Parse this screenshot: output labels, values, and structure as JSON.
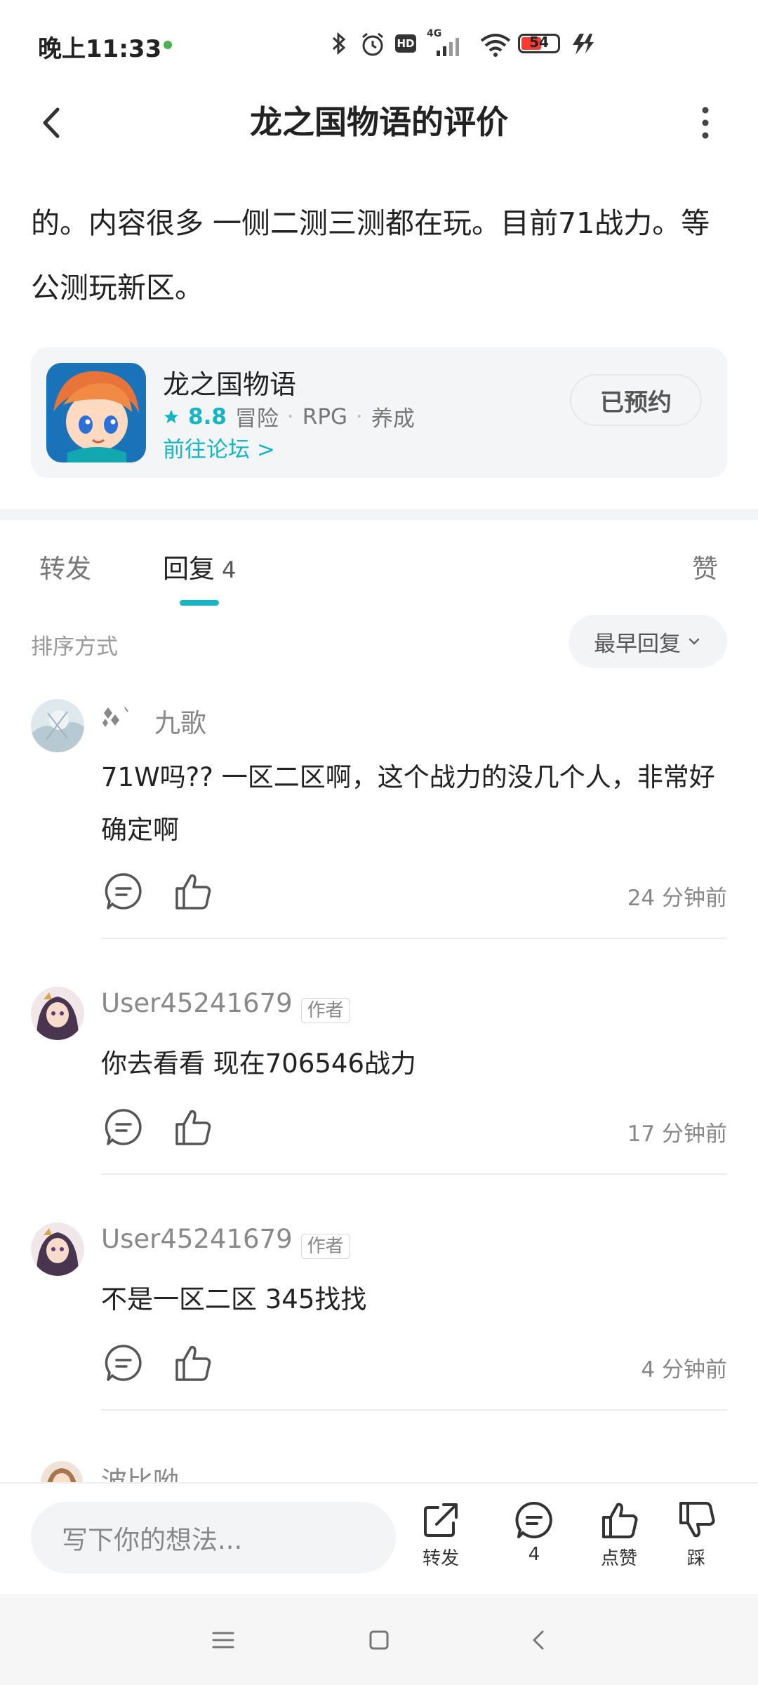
{
  "status_bar": {
    "time": "晚上11:33",
    "battery": "54",
    "network": "4G",
    "hd": "HD"
  },
  "header": {
    "title": "龙之国物语的评价"
  },
  "review": {
    "text": "的。内容很多 一侧二测三测都在玩。目前71战力。等公测玩新区。"
  },
  "game_card": {
    "name": "龙之国物语",
    "rating": "8.8",
    "tags": [
      "冒险",
      "RPG",
      "养成"
    ],
    "forum_link": "前往论坛 >",
    "reserve_button": "已预约"
  },
  "tabs": {
    "forward": "转发",
    "reply": "回复",
    "reply_count": "4",
    "like": "赞"
  },
  "sort": {
    "label": "排序方式",
    "button": "最早回复"
  },
  "comments": [
    {
      "username": "九歌",
      "text": "71W吗?? 一区二区啊，这个战力的没几个人，非常好确定啊",
      "time": "24 分钟前"
    },
    {
      "username": "User45241679",
      "tag": "作者",
      "text": "你去看看 现在706546战力",
      "time": "17 分钟前"
    },
    {
      "username": "User45241679",
      "tag": "作者",
      "text": "不是一区二区 345找找",
      "time": "4 分钟前"
    },
    {
      "username": "波比呦"
    }
  ],
  "bottom_bar": {
    "input_placeholder": "写下你的想法...",
    "forward_label": "转发",
    "comment_count": "4",
    "like_label": "点赞",
    "dislike_label": "踩"
  },
  "icons": {
    "back": "chevron-left-icon",
    "more": "more-vertical-icon",
    "comment": "comment-icon",
    "like": "thumbs-up-icon",
    "share": "share-icon",
    "dislike": "thumbs-down-icon"
  },
  "colors": {
    "accent": "#15b6c3",
    "text": "#222222",
    "muted": "#888888"
  }
}
